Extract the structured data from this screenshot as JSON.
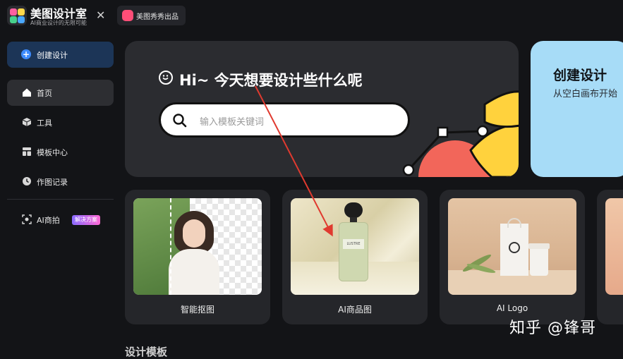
{
  "app": {
    "title": "美图设计室",
    "subtitle": "AI商业设计的无限可能",
    "brand_tab_label": "美图秀秀出品",
    "close_glyph": "✕"
  },
  "sidebar": {
    "create_button": "创建设计",
    "items": [
      {
        "label": "首页",
        "icon": "home-icon",
        "active": true
      },
      {
        "label": "工具",
        "icon": "cube-icon",
        "active": false
      },
      {
        "label": "模板中心",
        "icon": "template-icon",
        "active": false
      },
      {
        "label": "作图记录",
        "icon": "clock-icon",
        "active": false
      }
    ],
    "ai_item": {
      "label": "AI商拍",
      "icon": "scan-icon",
      "badge": "解决方案"
    }
  },
  "hero": {
    "greeting": "Hi~ 今天想要设计些什么呢",
    "search_placeholder": "输入模板关键词"
  },
  "create_card": {
    "title": "创建设计",
    "subtitle": "从空白画布开始"
  },
  "feature_cards": [
    {
      "label": "智能抠图"
    },
    {
      "label": "AI商品图",
      "product_text": "LUSTRE"
    },
    {
      "label": "AI Logo"
    }
  ],
  "section_peek": "设计模板",
  "watermark": "知乎 @锋哥",
  "colors": {
    "background": "#131417",
    "accent_blue": "#3d8bff",
    "annotation_arrow": "#e03a2f",
    "create_card_bg": "#a7dcf7"
  }
}
